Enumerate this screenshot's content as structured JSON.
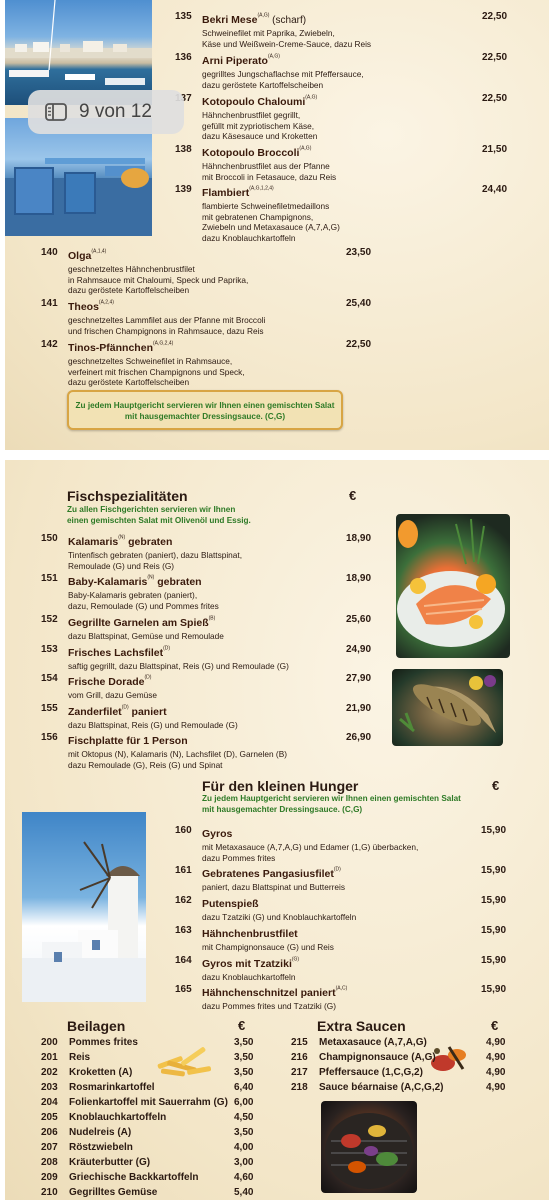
{
  "badge": {
    "text": "9 von 12"
  },
  "page1": {
    "items": [
      {
        "no": "135",
        "title": "Bekri Mese",
        "sup": "(A,G)",
        "extra": " (scharf)",
        "desc": [
          "Schweinefilet mit Paprika, Zwiebeln,",
          "Käse und Weißwein-Creme-Sauce, dazu Reis"
        ],
        "price": "22,50"
      },
      {
        "no": "136",
        "title": "Arni Piperato",
        "sup": "(A,G)",
        "extra": "",
        "desc": [
          "gegrilltes Jungschaflachse mit Pfeffersauce,",
          "dazu geröstete Kartoffelscheiben"
        ],
        "price": "22,50"
      },
      {
        "no": "137",
        "title": "Kotopoulo Chaloumi",
        "sup": "(A,G)",
        "extra": "",
        "desc": [
          "Hähnchenbrustfilet gegrillt,",
          "gefüllt mit zypriotischem Käse,",
          "dazu Käsesauce und Kroketten"
        ],
        "price": "22,50"
      },
      {
        "no": "138",
        "title": "Kotopoulo Broccoli",
        "sup": "(A,G)",
        "extra": "",
        "desc": [
          "Hähnchenbrustfilet aus der Pfanne",
          "mit Broccoli in Fetasauce, dazu Reis"
        ],
        "price": "21,50"
      },
      {
        "no": "139",
        "title": "Flambiert",
        "sup": "(A,G,1,2,4)",
        "extra": "",
        "desc": [
          "flambierte Schweinefiletmedaillons",
          "mit gebratenen Champignons,",
          "Zwiebeln und Metaxasauce (A,7,A,G)",
          "dazu Knoblauchkartoffeln"
        ],
        "price": "24,40"
      },
      {
        "no": "140",
        "title": "Olga",
        "sup": "(A,1,4)",
        "extra": "",
        "desc": [
          "geschnetzeltes Hähnchenbrustfilet",
          "in Rahmsauce mit Chaloumi, Speck und Paprika,",
          "dazu geröstete Kartoffelscheiben"
        ],
        "price": "23,50"
      },
      {
        "no": "141",
        "title": "Theos",
        "sup": "(A,2,4)",
        "extra": "",
        "desc": [
          "geschnetzeltes Lammfilet aus der Pfanne mit Broccoli",
          "und frischen Champignons in Rahmsauce, dazu Reis"
        ],
        "price": "25,40"
      },
      {
        "no": "142",
        "title": "Tinos-Pfännchen",
        "sup": "(A,G,2,4)",
        "extra": "",
        "desc": [
          "geschnetzeltes Schweinefilet in Rahmsauce,",
          "verfeinert mit frischen Champignons und Speck,",
          "dazu geröstete Kartoffelscheiben"
        ],
        "price": "22,50"
      }
    ],
    "salad_note": [
      "Zu jedem Hauptgericht servieren wir Ihnen einen gemischten Salat",
      "mit hausgemachter Dressingsauce. (C,G)"
    ]
  },
  "fish": {
    "title": "Fischspezialitäten",
    "euro": "€",
    "note": [
      "Zu allen Fischgerichten servieren wir Ihnen",
      "einen gemischten Salat mit Olivenöl und Essig."
    ],
    "items": [
      {
        "no": "150",
        "title": "Kalamaris",
        "sup": "(N)",
        "title2": " gebraten",
        "desc": [
          "Tintenfisch gebraten (paniert), dazu Blattspinat,",
          "Remoulade (G) und Reis (G)"
        ],
        "price": "18,90"
      },
      {
        "no": "151",
        "title": "Baby-Kalamaris",
        "sup": "(N)",
        "title2": " gebraten",
        "desc": [
          "Baby-Kalamaris gebraten (paniert),",
          "dazu, Remoulade (G) und Pommes frites"
        ],
        "price": "18,90"
      },
      {
        "no": "152",
        "title": "Gegrillte Garnelen am Spieß",
        "sup": "(B)",
        "title2": "",
        "desc": [
          "dazu Blattspinat, Gemüse und Remoulade"
        ],
        "price": "25,60"
      },
      {
        "no": "153",
        "title": "Frisches Lachsfilet",
        "sup": "(D)",
        "title2": "",
        "desc": [
          "saftig gegrillt, dazu Blattspinat, Reis (G) und Remoulade (G)"
        ],
        "price": "24,90"
      },
      {
        "no": "154",
        "title": "Frische Dorade",
        "sup": "(D)",
        "title2": "",
        "desc": [
          "vom Grill, dazu Gemüse"
        ],
        "price": "27,90"
      },
      {
        "no": "155",
        "title": "Zanderfilet",
        "sup": "(D)",
        "title2": " paniert",
        "desc": [
          "dazu Blattspinat, Reis (G) und Remoulade (G)"
        ],
        "price": "21,90"
      },
      {
        "no": "156",
        "title": "Fischplatte für 1 Person",
        "sup": "",
        "title2": "",
        "desc": [
          "mit Oktopus (N), Kalamaris (N), Lachsfilet (D), Garnelen (B)",
          "dazu Remoulade (G), Reis (G) und Spinat"
        ],
        "price": "26,90"
      }
    ]
  },
  "small": {
    "title": "Für den kleinen Hunger",
    "euro": "€",
    "note": [
      "Zu jedem Hauptgericht servieren wir Ihnen einen gemischten Salat",
      "mit hausgemachter Dressingsauce. (C,G)"
    ],
    "items": [
      {
        "no": "160",
        "title": "Gyros",
        "sup": "",
        "desc": [
          "mit Metaxasauce (A,7,A,G) und Edamer (1,G) überbacken,",
          "dazu Pommes frites"
        ],
        "price": "15,90"
      },
      {
        "no": "161",
        "title": "Gebratenes Pangasiusfilet",
        "sup": "(D)",
        "desc": [
          "paniert, dazu Blattspinat und Butterreis"
        ],
        "price": "15,90"
      },
      {
        "no": "162",
        "title": "Putenspieß",
        "sup": "",
        "desc": [
          "dazu Tzatziki (G) und Knoblauchkartoffeln"
        ],
        "price": "15,90"
      },
      {
        "no": "163",
        "title": "Hähnchenbrustfilet",
        "sup": "",
        "desc": [
          "mit Champignonsauce (G) und Reis"
        ],
        "price": "15,90"
      },
      {
        "no": "164",
        "title": "Gyros mit Tzatziki",
        "sup": "(G)",
        "desc": [
          "dazu Knoblauchkartoffeln"
        ],
        "price": "15,90"
      },
      {
        "no": "165",
        "title": "Hähnchenschnitzel paniert",
        "sup": "(A,C)",
        "desc": [
          "dazu Pommes frites und Tzatziki (G)"
        ],
        "price": "15,90"
      }
    ]
  },
  "sides": {
    "title": "Beilagen",
    "euro": "€",
    "items": [
      {
        "no": "200",
        "title": "Pommes frites",
        "price": "3,50"
      },
      {
        "no": "201",
        "title": "Reis",
        "price": "3,50"
      },
      {
        "no": "202",
        "title": "Kroketten (A)",
        "price": "3,50"
      },
      {
        "no": "203",
        "title": "Rosmarinkartoffel",
        "price": "6,40"
      },
      {
        "no": "204",
        "title": "Folienkartoffel mit Sauerrahm (G)",
        "price": "6,00"
      },
      {
        "no": "205",
        "title": "Knoblauchkartoffeln",
        "price": "4,50"
      },
      {
        "no": "206",
        "title": "Nudelreis (A)",
        "price": "3,50"
      },
      {
        "no": "207",
        "title": "Röstzwiebeln",
        "price": "4,00"
      },
      {
        "no": "208",
        "title": "Kräuterbutter (G)",
        "price": "3,00"
      },
      {
        "no": "209",
        "title": "Griechische Backkartoffeln",
        "price": "4,60"
      },
      {
        "no": "210",
        "title": "Gegrilltes Gemüse",
        "price": "5,40"
      }
    ]
  },
  "sauces": {
    "title": "Extra Saucen",
    "euro": "€",
    "items": [
      {
        "no": "215",
        "title": "Metaxasauce (A,7,A,G)",
        "price": "4,90"
      },
      {
        "no": "216",
        "title": "Champignonsauce (A,G)",
        "price": "4,90"
      },
      {
        "no": "217",
        "title": "Pfeffersauce (1,C,G,2)",
        "price": "4,90"
      },
      {
        "no": "218",
        "title": "Sauce béarnaise (A,C,G,2)",
        "price": "4,90"
      }
    ]
  },
  "colors": {
    "paper": "#f6ecd6",
    "green": "#2e7a26",
    "gold": "#d8a544"
  },
  "icons": {
    "badge": "pages-icon"
  }
}
